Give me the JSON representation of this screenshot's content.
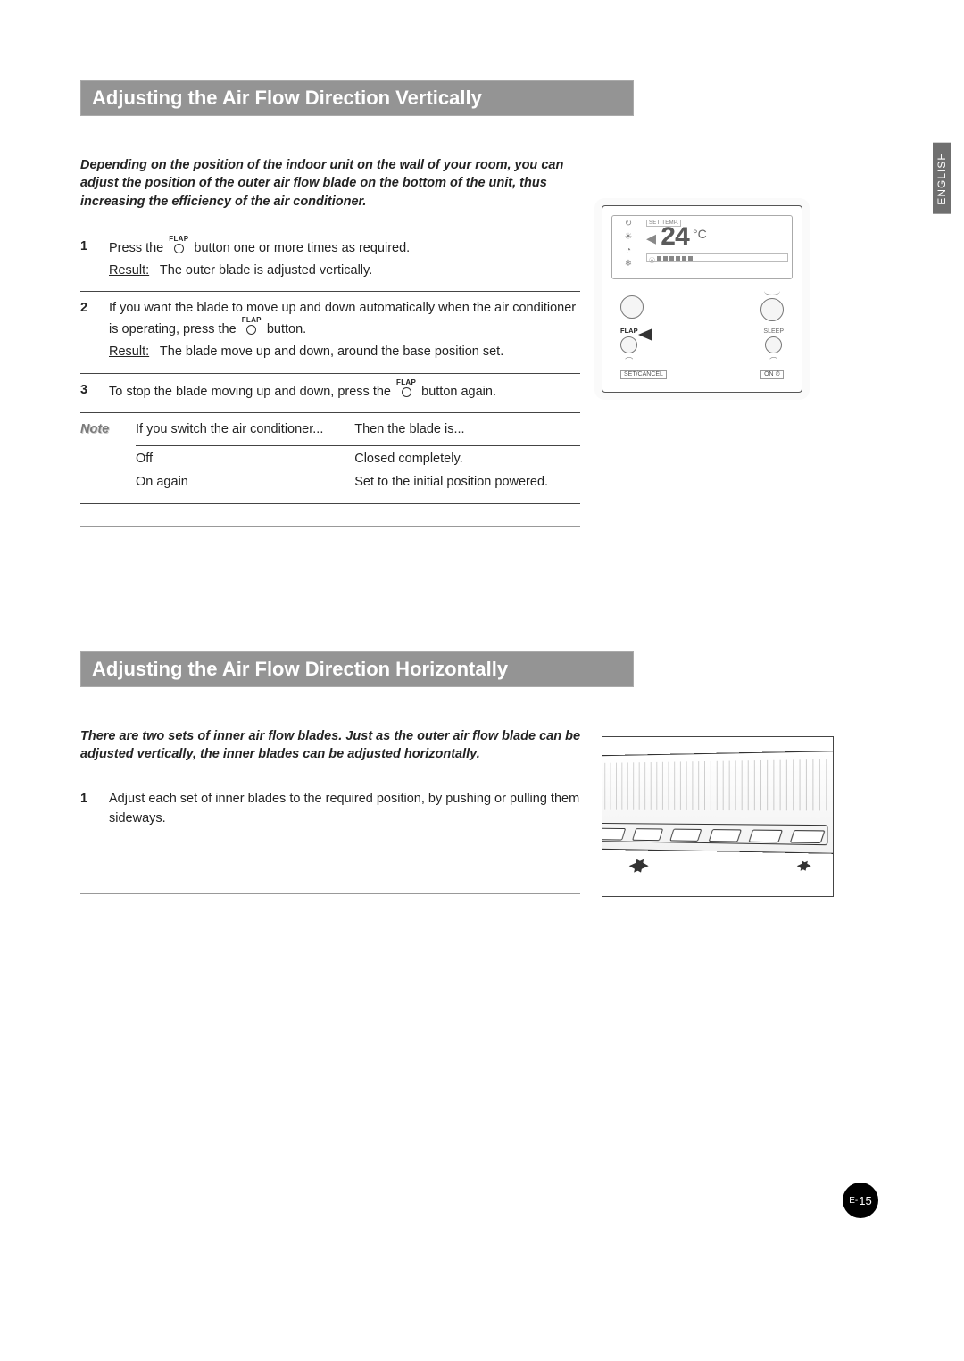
{
  "language_tab": "ENGLISH",
  "page_number_prefix": "E-",
  "page_number": "15",
  "sections": [
    {
      "heading": "Adjusting the Air Flow Direction Vertically",
      "intro": "Depending on the position of the indoor unit on the wall of your room, you can adjust the position of the outer air flow blade on the bottom of the unit, thus increasing the efficiency of the air conditioner.",
      "steps": [
        {
          "num": "1",
          "pre": "Press the ",
          "btn": "FLAP",
          "post": " button one or more times as required.",
          "result_label": "Result:",
          "result_text": "The outer blade is adjusted vertically."
        },
        {
          "num": "2",
          "pre": "If you want the blade to move up and down automatically when the air conditioner is operating, press the ",
          "btn": "FLAP",
          "post": " button.",
          "result_label": "Result:",
          "result_text": "The blade move up and down, around the base position set."
        },
        {
          "num": "3",
          "pre": "To stop the blade moving up and down, press the ",
          "btn": "FLAP",
          "post": " button again."
        }
      ],
      "note": {
        "label": "Note",
        "col1_header": "If you switch the air conditioner...",
        "col2_header": "Then the blade is...",
        "rows": [
          {
            "c1": "Off",
            "c2": "Closed completely."
          },
          {
            "c1": "On again",
            "c2": "Set to the initial position powered."
          }
        ]
      },
      "remote": {
        "set_temp_label": "SET TEMP.",
        "temperature": "24",
        "deg": "°C",
        "flap_label": "FLAP",
        "sleep_label": "SLEEP",
        "set_cancel_label": "SET/CANCEL",
        "on_label": "ON ⏱"
      }
    },
    {
      "heading": "Adjusting the Air Flow Direction Horizontally",
      "intro": "There are two sets of inner air flow blades. Just as the outer air flow blade can be adjusted vertically, the inner blades can be adjusted horizontally.",
      "steps": [
        {
          "num": "1",
          "text": "Adjust each set of inner blades to the required position, by pushing or pulling them sideways."
        }
      ]
    }
  ]
}
